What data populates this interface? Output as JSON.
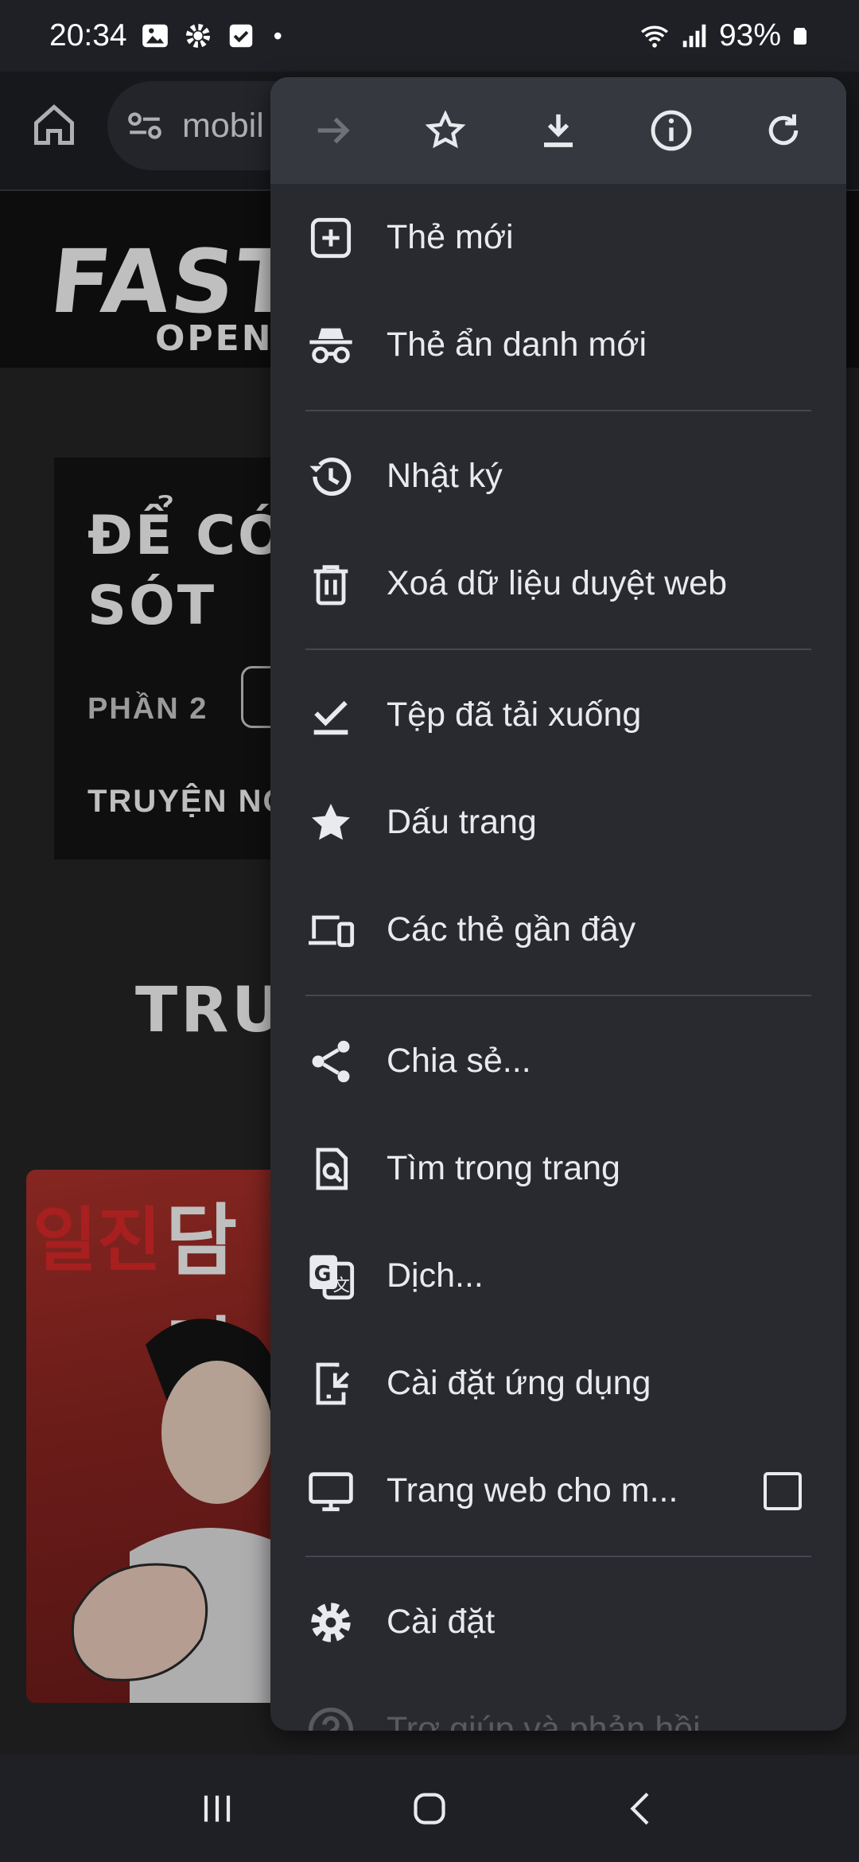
{
  "status_bar": {
    "time": "20:34",
    "battery": "93%",
    "dot": "•"
  },
  "toolbar": {
    "url": "mobil"
  },
  "page": {
    "logo_main": "FASTS",
    "logo_sub": "OPEN I",
    "card_title": "ĐỂ CÓ\nSÓT",
    "card_part": "PHẦN 2",
    "card_hot": "TRUYỆN NỔ",
    "section_title": "TRU",
    "cover_kr1": "일진",
    "cover_kr2": "담당"
  },
  "menu": {
    "top_icons": [
      "forward-icon",
      "bookmark-star-icon",
      "download-icon",
      "info-icon",
      "reload-icon"
    ],
    "items": [
      {
        "label": "Thẻ mới",
        "icon": "new-tab-icon"
      },
      {
        "label": "Thẻ ẩn danh mới",
        "icon": "incognito-icon"
      },
      {
        "label": "Nhật ký",
        "icon": "history-icon"
      },
      {
        "label": "Xoá dữ liệu duyệt web",
        "icon": "trash-icon"
      },
      {
        "label": "Tệp đã tải xuống",
        "icon": "downloads-icon"
      },
      {
        "label": "Dấu trang",
        "icon": "star-icon"
      },
      {
        "label": "Các thẻ gần đây",
        "icon": "devices-icon"
      },
      {
        "label": "Chia sẻ...",
        "icon": "share-icon"
      },
      {
        "label": "Tìm trong trang",
        "icon": "find-in-page-icon"
      },
      {
        "label": "Dịch...",
        "icon": "translate-icon"
      },
      {
        "label": "Cài đặt ứng dụng",
        "icon": "install-app-icon"
      },
      {
        "label": "Trang web cho m...",
        "icon": "desktop-icon",
        "checked": false
      },
      {
        "label": "Cài đặt",
        "icon": "settings-icon"
      },
      {
        "label": "Trợ giúp và phản hồi",
        "icon": "help-icon"
      }
    ]
  },
  "colors": {
    "menu_bg": "#292a2f",
    "menu_top_bg": "#363840",
    "text": "#e8eaed"
  }
}
